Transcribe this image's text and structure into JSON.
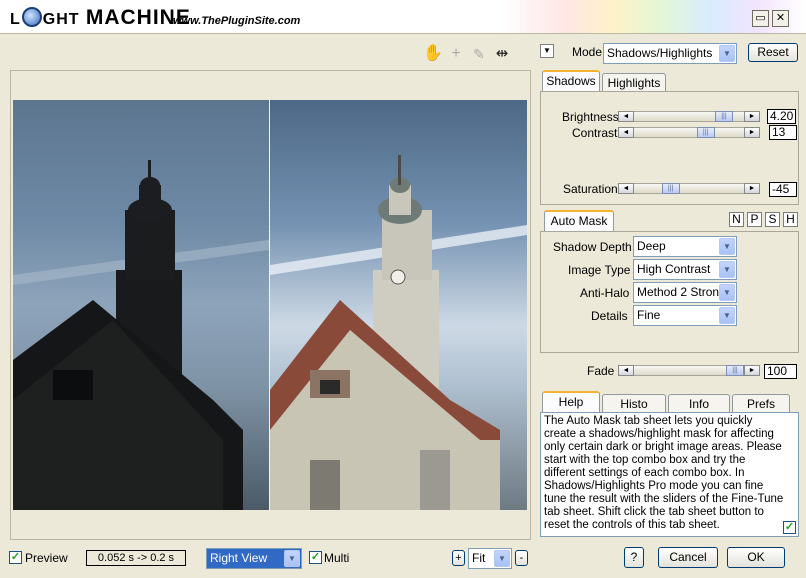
{
  "titlebar": {
    "logo_light": "LIGHT",
    "logo_machine": "MACHINE",
    "site_url": "www.ThePluginSite.com",
    "restore_label": "▭",
    "close_label": "✕"
  },
  "toolbar": {
    "icons": [
      "hand-icon",
      "crosshair-icon",
      "eyedropper-icon",
      "split-view-icon"
    ]
  },
  "mode": {
    "label": "Mode",
    "value": "Shadows/Highlights",
    "reset_label": "Reset"
  },
  "tone_tabs": {
    "tabs": [
      "Shadows",
      "Highlights"
    ],
    "active": "Shadows",
    "brightness": {
      "label": "Brightness",
      "value": "4.20",
      "fraction": 0.88
    },
    "contrast": {
      "label": "Contrast",
      "value": "13",
      "fraction": 0.68
    },
    "saturation": {
      "label": "Saturation",
      "value": "-45",
      "fraction": 0.3
    }
  },
  "auto_mask": {
    "tab_label": "Auto Mask",
    "letter_buttons": [
      "N",
      "P",
      "S",
      "H"
    ],
    "fields": [
      {
        "label": "Shadow Depth",
        "value": "Deep"
      },
      {
        "label": "Image Type",
        "value": "High Contrast"
      },
      {
        "label": "Anti-Halo",
        "value": "Method 2 Strong"
      },
      {
        "label": "Details",
        "value": "Fine"
      }
    ]
  },
  "fade": {
    "label": "Fade",
    "value": "100",
    "fraction": 1.0
  },
  "info_tabs": {
    "tabs": [
      "Help",
      "Histo",
      "Info",
      "Prefs"
    ],
    "active": "Help",
    "help_text": "The Auto Mask tab sheet lets you quickly create a shadows/highlight mask for affecting only certain dark or bright image areas. Please start with the top combo box and try the different settings of each combo box. In Shadows/Highlights Pro mode you can fine tune the result with the sliders of the Fine-Tune tab sheet. Shift click the tab sheet button to reset the controls of this tab sheet.",
    "help_checked": true
  },
  "bottom": {
    "preview_label": "Preview",
    "preview_checked": true,
    "timing": "0.052 s -> 0.2 s",
    "view_value": "Right View",
    "multi_label": "Multi",
    "multi_checked": true,
    "zoom_plus": "+",
    "zoom_value": "Fit",
    "zoom_minus": "-",
    "help_button": "?",
    "cancel_label": "Cancel",
    "ok_label": "OK"
  }
}
